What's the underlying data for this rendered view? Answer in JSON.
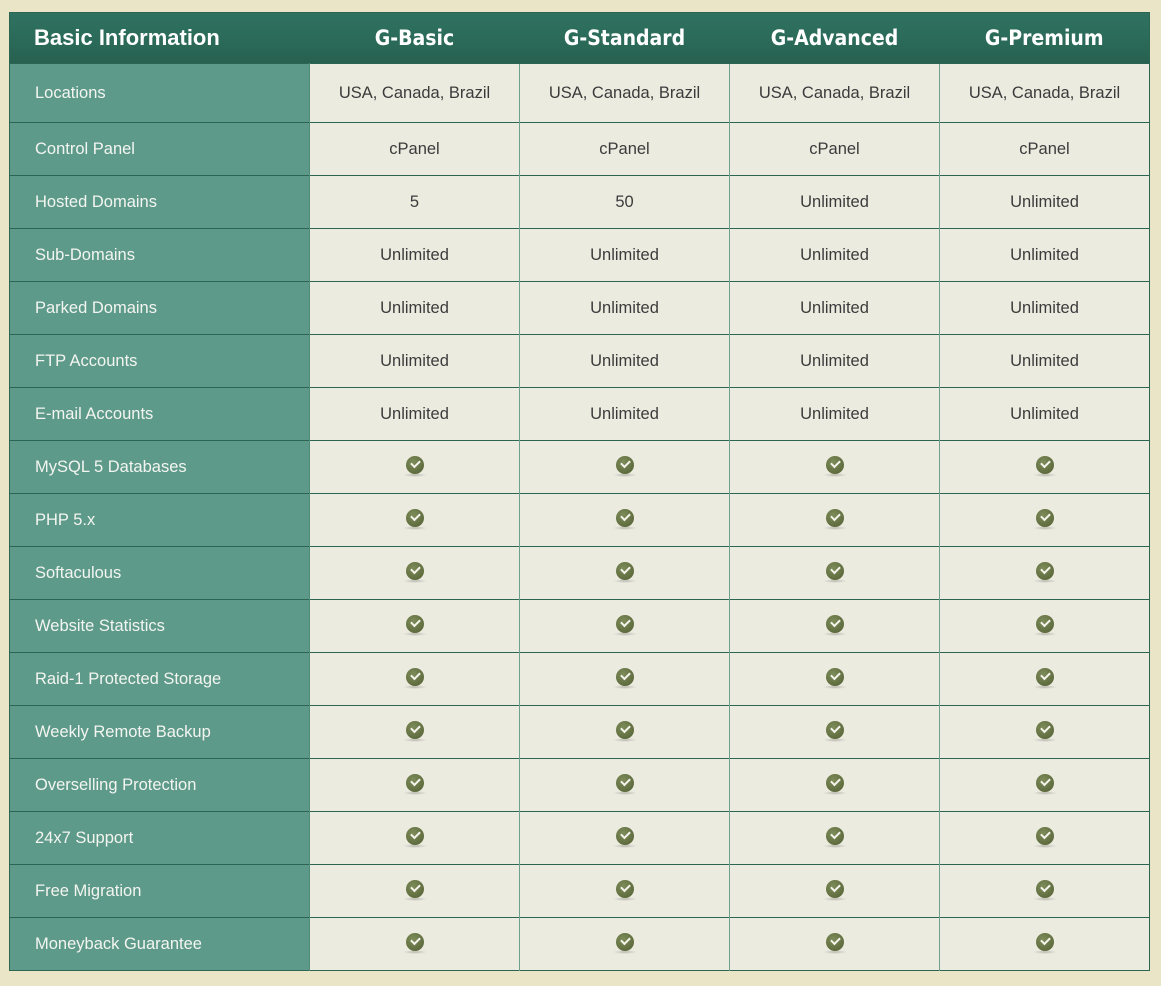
{
  "table": {
    "header": {
      "label": "Basic Information",
      "plans": [
        "G-Basic",
        "G-Standard",
        "G-Advanced",
        "G-Premium"
      ]
    },
    "rows": [
      {
        "label": "Locations",
        "values": [
          "USA, Canada, Brazil",
          "USA, Canada, Brazil",
          "USA, Canada, Brazil",
          "USA, Canada, Brazil"
        ]
      },
      {
        "label": "Control Panel",
        "values": [
          "cPanel",
          "cPanel",
          "cPanel",
          "cPanel"
        ]
      },
      {
        "label": "Hosted Domains",
        "values": [
          "5",
          "50",
          "Unlimited",
          "Unlimited"
        ]
      },
      {
        "label": "Sub-Domains",
        "values": [
          "Unlimited",
          "Unlimited",
          "Unlimited",
          "Unlimited"
        ]
      },
      {
        "label": "Parked Domains",
        "values": [
          "Unlimited",
          "Unlimited",
          "Unlimited",
          "Unlimited"
        ]
      },
      {
        "label": "FTP Accounts",
        "values": [
          "Unlimited",
          "Unlimited",
          "Unlimited",
          "Unlimited"
        ]
      },
      {
        "label": "E-mail Accounts",
        "values": [
          "Unlimited",
          "Unlimited",
          "Unlimited",
          "Unlimited"
        ]
      },
      {
        "label": "MySQL 5 Databases",
        "values": [
          "check-icon",
          "check-icon",
          "check-icon",
          "check-icon"
        ]
      },
      {
        "label": "PHP 5.x",
        "values": [
          "check-icon",
          "check-icon",
          "check-icon",
          "check-icon"
        ]
      },
      {
        "label": "Softaculous",
        "values": [
          "check-icon",
          "check-icon",
          "check-icon",
          "check-icon"
        ]
      },
      {
        "label": "Website Statistics",
        "values": [
          "check-icon",
          "check-icon",
          "check-icon",
          "check-icon"
        ]
      },
      {
        "label": "Raid-1 Protected Storage",
        "values": [
          "check-icon",
          "check-icon",
          "check-icon",
          "check-icon"
        ]
      },
      {
        "label": "Weekly Remote Backup",
        "values": [
          "check-icon",
          "check-icon",
          "check-icon",
          "check-icon"
        ]
      },
      {
        "label": "Overselling Protection",
        "values": [
          "check-icon",
          "check-icon",
          "check-icon",
          "check-icon"
        ]
      },
      {
        "label": "24x7 Support",
        "values": [
          "check-icon",
          "check-icon",
          "check-icon",
          "check-icon"
        ]
      },
      {
        "label": "Free Migration",
        "values": [
          "check-icon",
          "check-icon",
          "check-icon",
          "check-icon"
        ]
      },
      {
        "label": "Moneyback Guarantee",
        "values": [
          "check-icon",
          "check-icon",
          "check-icon",
          "check-icon"
        ]
      }
    ]
  },
  "colors": {
    "page_background": "#ebe5c7",
    "header_background": "#2b6a59",
    "label_column": "#5e9a8a",
    "cell_background": "#ecebe0",
    "check_icon": "#5f6c3e"
  }
}
